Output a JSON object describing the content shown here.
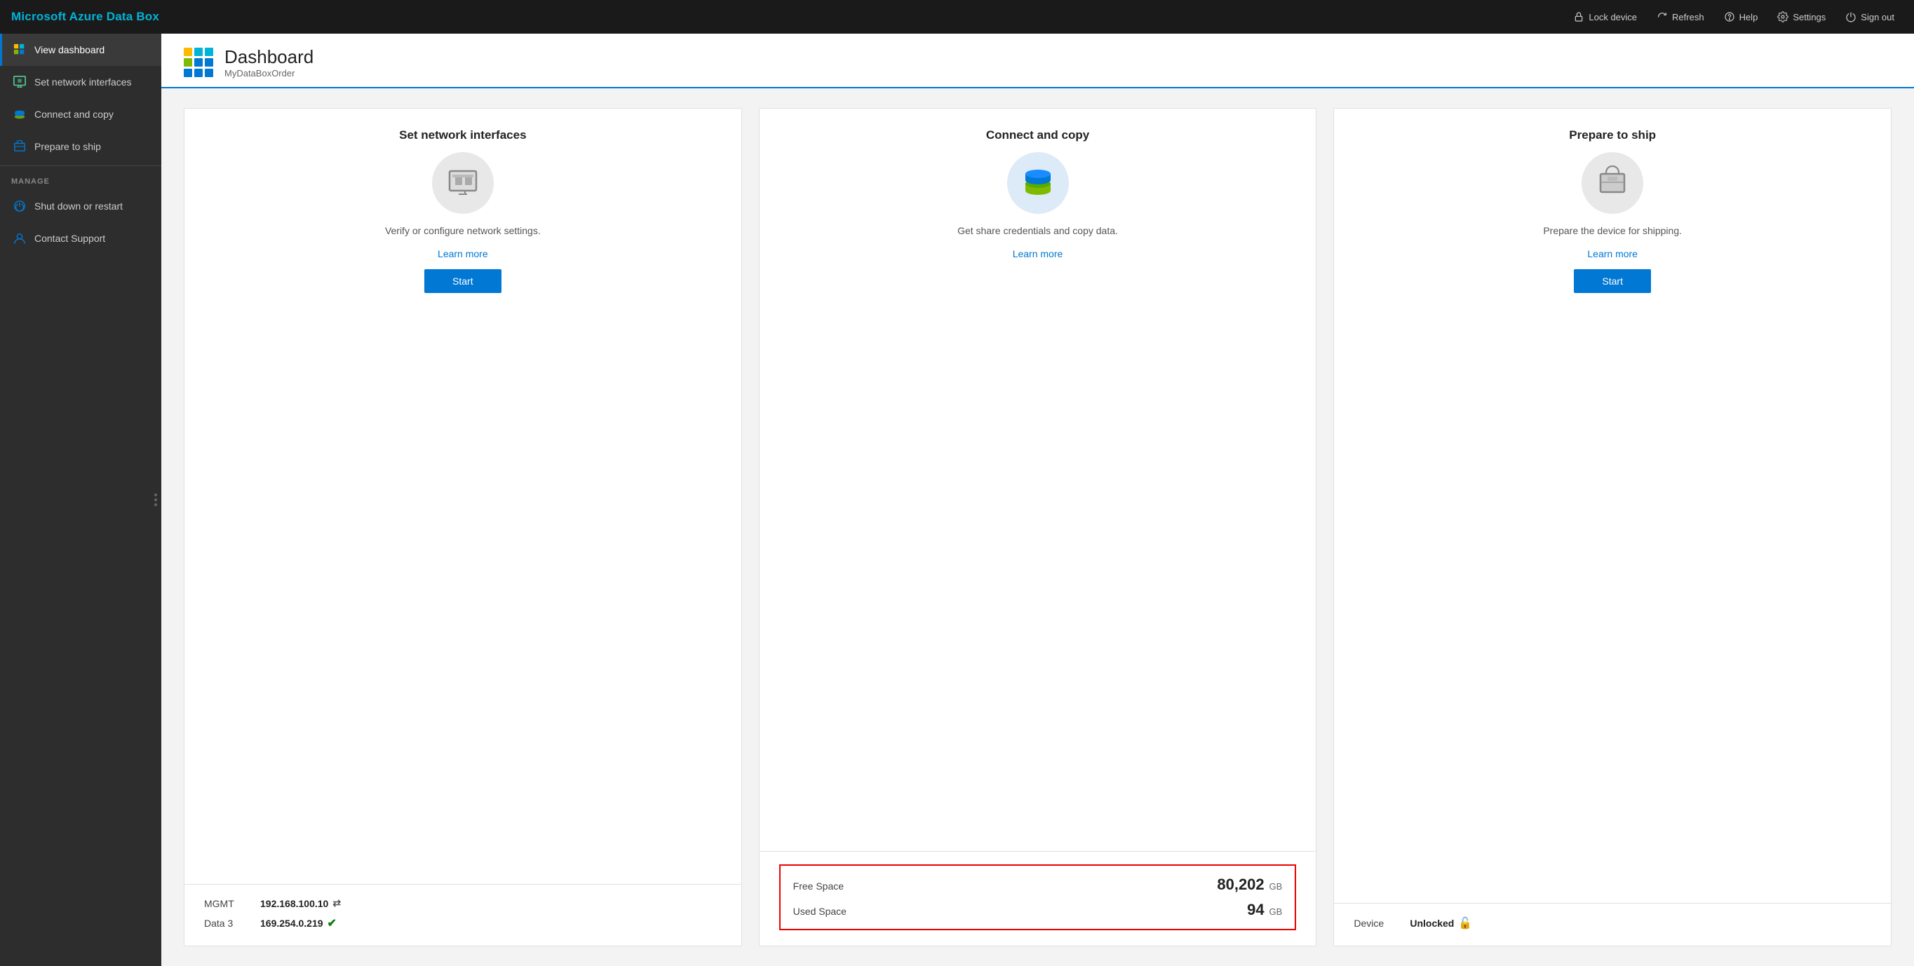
{
  "app": {
    "title": "Microsoft Azure Data Box"
  },
  "topnav": {
    "buttons": [
      {
        "id": "lock-device",
        "label": "Lock device",
        "icon": "lock"
      },
      {
        "id": "refresh",
        "label": "Refresh",
        "icon": "refresh"
      },
      {
        "id": "help",
        "label": "Help",
        "icon": "help"
      },
      {
        "id": "settings",
        "label": "Settings",
        "icon": "settings"
      },
      {
        "id": "sign-out",
        "label": "Sign out",
        "icon": "power"
      }
    ]
  },
  "sidebar": {
    "items": [
      {
        "id": "view-dashboard",
        "label": "View dashboard",
        "icon": "grid",
        "active": true
      },
      {
        "id": "set-network-interfaces",
        "label": "Set network interfaces",
        "icon": "network",
        "active": false
      },
      {
        "id": "connect-and-copy",
        "label": "Connect and copy",
        "icon": "copy",
        "active": false
      },
      {
        "id": "prepare-to-ship",
        "label": "Prepare to ship",
        "icon": "ship",
        "active": false
      }
    ],
    "manage_label": "MANAGE",
    "manage_items": [
      {
        "id": "shut-down-restart",
        "label": "Shut down or restart",
        "icon": "power"
      },
      {
        "id": "contact-support",
        "label": "Contact Support",
        "icon": "support"
      }
    ]
  },
  "page": {
    "title": "Dashboard",
    "subtitle": "MyDataBoxOrder"
  },
  "cards": [
    {
      "id": "set-network-interfaces",
      "title": "Set network interfaces",
      "description": "Verify or configure network settings.",
      "learn_more_label": "Learn more",
      "start_label": "Start",
      "bottom": {
        "rows": [
          {
            "label": "MGMT",
            "value": "192.168.100.10",
            "icon": "swap"
          },
          {
            "label": "Data 3",
            "value": "169.254.0.219",
            "icon": "check"
          }
        ]
      }
    },
    {
      "id": "connect-and-copy",
      "title": "Connect and copy",
      "description": "Get share credentials and copy data.",
      "learn_more_label": "Learn more",
      "start_label": null,
      "bottom": {
        "space_box": true,
        "free_space_label": "Free Space",
        "free_space_value": "80,202",
        "free_space_unit": "GB",
        "used_space_label": "Used Space",
        "used_space_value": "94",
        "used_space_unit": "GB"
      }
    },
    {
      "id": "prepare-to-ship",
      "title": "Prepare to ship",
      "description": "Prepare the device for shipping.",
      "learn_more_label": "Learn more",
      "start_label": "Start",
      "bottom": {
        "device_label": "Device",
        "device_value": "Unlocked"
      }
    }
  ],
  "grid_colors": [
    "#ffb900",
    "#00b4d8",
    "#00b4d8",
    "#7fba00",
    "#0078d4",
    "#0078d4",
    "#0078d4",
    "#0078d4",
    "#0078d4"
  ]
}
